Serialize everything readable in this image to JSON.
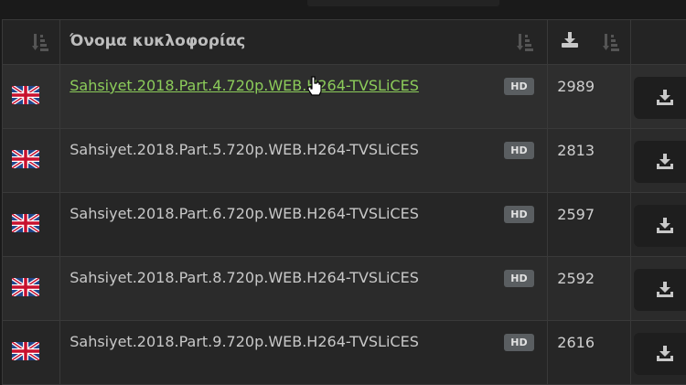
{
  "table": {
    "headers": {
      "name": "Όνομα κυκλοφορίας"
    },
    "rows": [
      {
        "name": "Sahsiyet.2018.Part.4.720p.WEB.H264-TVSLiCES",
        "quality": "HD",
        "downloads": "2989",
        "language_flag": "uk-flag-icon",
        "hovered": true
      },
      {
        "name": "Sahsiyet.2018.Part.5.720p.WEB.H264-TVSLiCES",
        "quality": "HD",
        "downloads": "2813",
        "language_flag": "uk-flag-icon"
      },
      {
        "name": "Sahsiyet.2018.Part.6.720p.WEB.H264-TVSLiCES",
        "quality": "HD",
        "downloads": "2597",
        "language_flag": "uk-flag-icon"
      },
      {
        "name": "Sahsiyet.2018.Part.8.720p.WEB.H264-TVSLiCES",
        "quality": "HD",
        "downloads": "2592",
        "language_flag": "uk-flag-icon"
      },
      {
        "name": "Sahsiyet.2018.Part.9.720p.WEB.H264-TVSLiCES",
        "quality": "HD",
        "downloads": "2616",
        "language_flag": "uk-flag-icon"
      }
    ]
  },
  "colors": {
    "link_active": "#8ccc5a",
    "badge_bg": "#5a5e61",
    "background": "#1a1a1a"
  }
}
